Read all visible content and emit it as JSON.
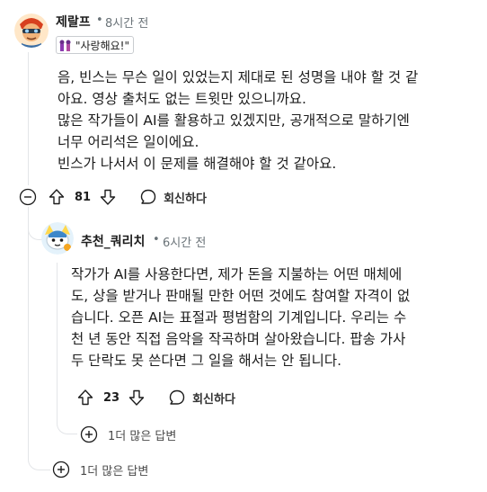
{
  "comment": {
    "username": "제랄프",
    "time": "8시간 전",
    "flair_text": "\"사랑해요!\"",
    "paragraphs": [
      "음, 빈스는 무슨 일이 있었는지 제대로 된 성명을 내야 할 것 같\n아요. 영상 출처도 없는 트윗만 있으니까요.",
      "많은 작가들이 AI를 활용하고 있겠지만, 공개적으로 말하기엔\n너무 어리석은 일이에요.",
      "빈스가 나서서 이 문제를 해결해야 할 것 같아요."
    ],
    "votes": "81",
    "reply_label": "회신하다"
  },
  "reply": {
    "username": "추천_쿼리치",
    "time": "6시간 전",
    "paragraphs": [
      "작가가 AI를 사용한다면, 제가 돈을 지불하는 어떤 매체에\n도, 상을 받거나 판매될 만한 어떤 것에도 참여할 자격이 없\n습니다. 오픈 AI는 표절과 평범함의 기계입니다. 우리는 수\n천 년 동안 직접 음악을 작곡하며 살아왔습니다. 팝송 가사\n두 단락도 못 쓴다면 그 일을 해서는 안 됩니다."
    ],
    "votes": "23",
    "reply_label": "회신하다"
  },
  "more_replies_inner": "1더 많은 답변",
  "more_replies_outer": "1더 많은 답변",
  "separator_dot": "•",
  "colors": {
    "accent": "#ff4500",
    "line": "#e3e5e8",
    "meta": "#6a7378"
  }
}
